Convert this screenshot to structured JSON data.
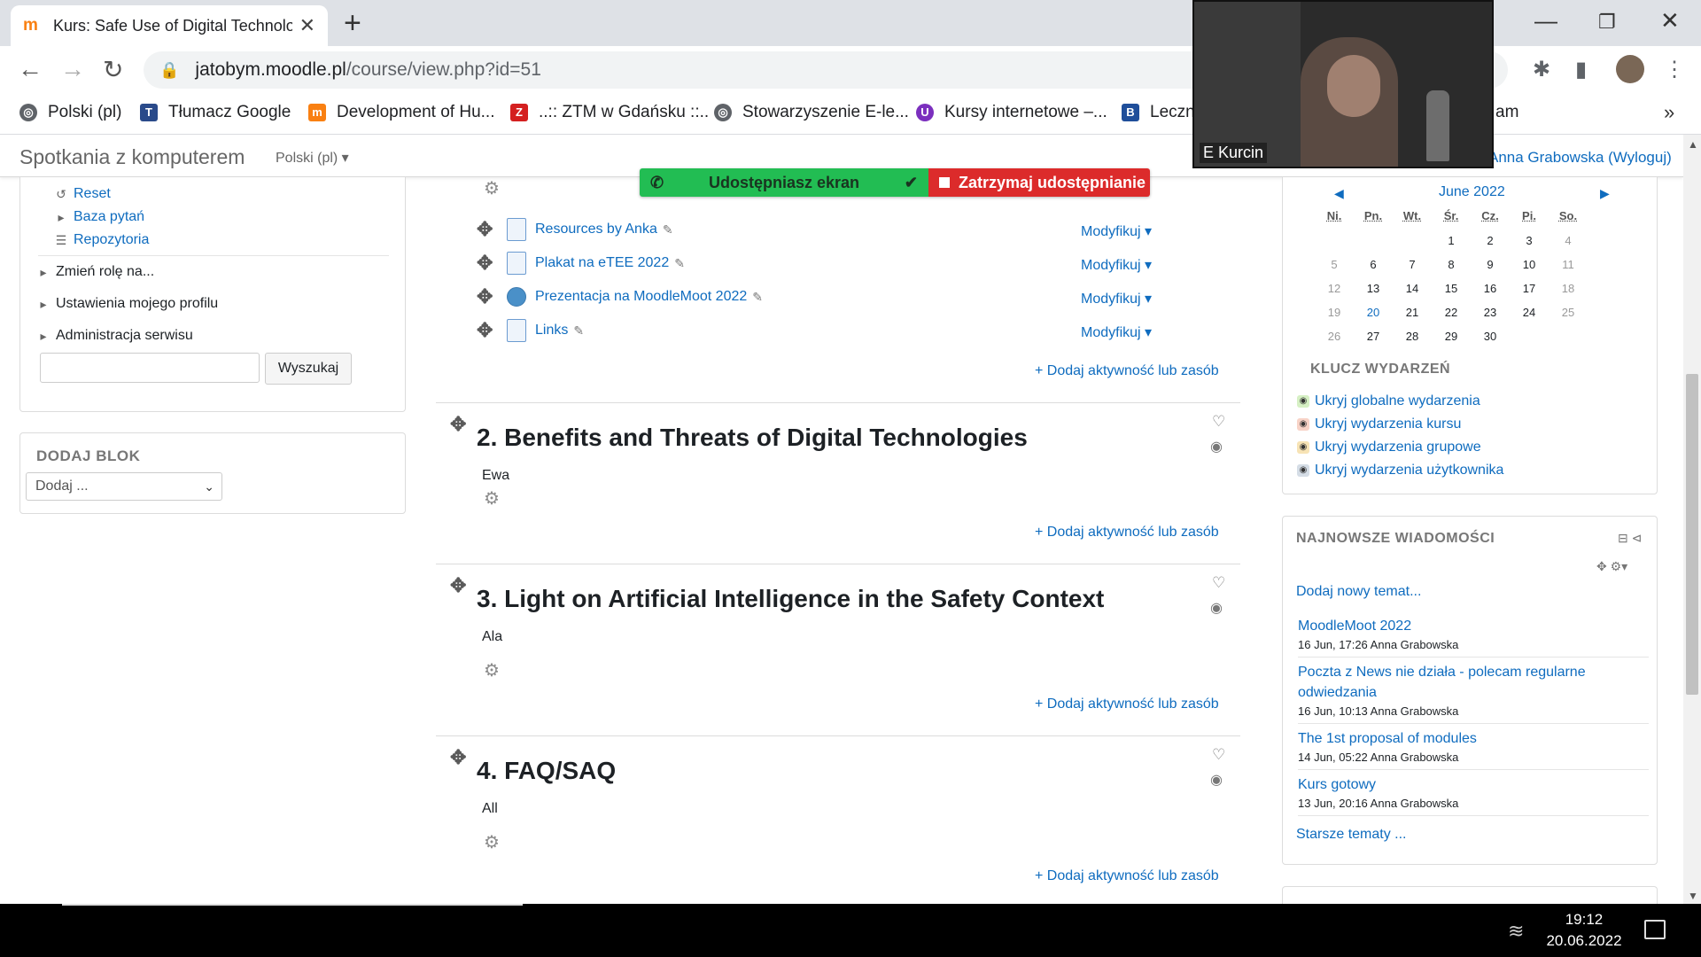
{
  "browser": {
    "tab_title": "Kurs: Safe Use of Digital Technolo",
    "url_host": "jatobym.moodle.pl",
    "url_path": "/course/view.php?id=51",
    "bookmarks": [
      "Polski (pl)",
      "Tłumacz Google",
      "Development of Hu...",
      "..:: ZTM w Gdańsku ::..",
      "Stowarzyszenie E-le...",
      "Kursy internetowe –...",
      "Leczn",
      "am"
    ]
  },
  "video": {
    "participant": "E Kurcin"
  },
  "navbar": {
    "site_name": "Spotkania z komputerem",
    "language": "Polski (pl)",
    "user": "Anna Grabowska (Wyloguj)"
  },
  "left_nav": {
    "reset": "Reset",
    "question_bank": "Baza pytań",
    "repositories": "Repozytoria",
    "switch_role": "Zmień rolę na...",
    "profile_settings": "Ustawienia mojego profilu",
    "site_admin": "Administracja serwisu",
    "search_button": "Wyszukaj"
  },
  "add_block": {
    "title": "DODAJ BLOK",
    "select_value": "Dodaj ..."
  },
  "share_bar": {
    "status": "Udostępniasz ekran",
    "stop": "Zatrzymaj udostępnianie"
  },
  "section1": {
    "activities": [
      {
        "name": "Resources by Anka",
        "modify": "Modyfikuj"
      },
      {
        "name": "Plakat na eTEE 2022",
        "modify": "Modyfikuj"
      },
      {
        "name": "Prezentacja na MoodleMoot 2022",
        "modify": "Modyfikuj"
      },
      {
        "name": "Links",
        "modify": "Modyfikuj"
      }
    ],
    "add_activity": "Dodaj aktywność lub zasób"
  },
  "sections": [
    {
      "title": "2. Benefits and Threats of Digital Technologies",
      "summary": "Ewa",
      "add_activity": "Dodaj aktywność lub zasób"
    },
    {
      "title": "3. Light on Artificial Intelligence in the Safety Context",
      "summary": "Ala",
      "add_activity": "Dodaj aktywność lub zasób"
    },
    {
      "title": "4. FAQ/SAQ",
      "summary": "All",
      "add_activity": "Dodaj aktywność lub zasób"
    }
  ],
  "calendar": {
    "month": "June 2022",
    "weekdays": [
      "Ni.",
      "Pn.",
      "Wt.",
      "Śr.",
      "Cz.",
      "Pi.",
      "So."
    ],
    "weeks": [
      [
        "",
        "",
        "",
        "1",
        "2",
        "3",
        "4"
      ],
      [
        "5",
        "6",
        "7",
        "8",
        "9",
        "10",
        "11"
      ],
      [
        "12",
        "13",
        "14",
        "15",
        "16",
        "17",
        "18"
      ],
      [
        "19",
        "20",
        "21",
        "22",
        "23",
        "24",
        "25"
      ],
      [
        "26",
        "27",
        "28",
        "29",
        "30",
        "",
        ""
      ]
    ],
    "today": "20",
    "key_title": "KLUCZ WYDARZEŃ",
    "key_items": [
      {
        "label": "Ukryj globalne wydarzenia",
        "color": "#d6f0c4"
      },
      {
        "label": "Ukryj wydarzenia kursu",
        "color": "#f8d3c7"
      },
      {
        "label": "Ukryj wydarzenia grupowe",
        "color": "#f7e3b5"
      },
      {
        "label": "Ukryj wydarzenia użytkownika",
        "color": "#d5dde6"
      }
    ]
  },
  "news": {
    "title": "NAJNOWSZE WIADOMOŚCI",
    "add_topic": "Dodaj nowy temat...",
    "items": [
      {
        "subject": "MoodleMoot 2022",
        "meta": "16 Jun, 17:26  Anna Grabowska"
      },
      {
        "subject": "Poczta z News nie działa - polecam regularne odwiedzania",
        "meta": "16 Jun, 10:13  Anna Grabowska"
      },
      {
        "subject": "The 1st proposal of modules",
        "meta": "14 Jun, 05:22  Anna Grabowska"
      },
      {
        "subject": "Kurs gotowy",
        "meta": "13 Jun, 20:16  Anna Grabowska"
      }
    ],
    "older": "Starsze tematy ..."
  },
  "taskbar": {
    "time": "19:12",
    "date": "20.06.2022"
  }
}
